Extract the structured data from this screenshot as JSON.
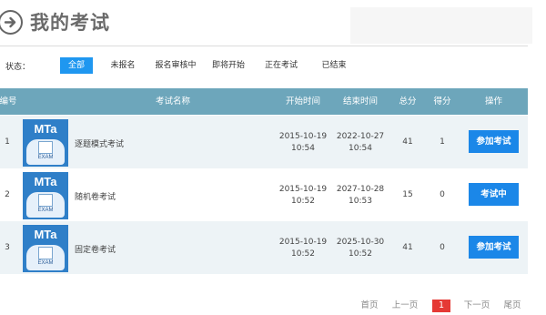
{
  "header": {
    "title": "我的考试"
  },
  "filter": {
    "label": "状态：",
    "items": [
      "全部",
      "未报名",
      "报名审核中",
      "即将开始",
      "正在考试",
      "已结束"
    ]
  },
  "table": {
    "columns": [
      "编号",
      "考试名称",
      "开始时间",
      "结束时间",
      "总分",
      "得分",
      "操作"
    ],
    "rows": [
      {
        "num": "1",
        "thumb_title": "MTa",
        "thumb_sub": "EXAM",
        "name": "逐题模式考试",
        "start_date": "2015-10-19",
        "start_time": "10:54",
        "end_date": "2022-10-27",
        "end_time": "10:54",
        "total": "41",
        "score": "1",
        "action": "参加考试"
      },
      {
        "num": "2",
        "thumb_title": "MTa",
        "thumb_sub": "EXAM",
        "name": "随机卷考试",
        "start_date": "2015-10-19",
        "start_time": "10:52",
        "end_date": "2027-10-28",
        "end_time": "10:53",
        "total": "15",
        "score": "0",
        "action": "考试中"
      },
      {
        "num": "3",
        "thumb_title": "MTa",
        "thumb_sub": "EXAM",
        "name": "固定卷考试",
        "start_date": "2015-10-19",
        "start_time": "10:52",
        "end_date": "2025-10-30",
        "end_time": "10:52",
        "total": "41",
        "score": "0",
        "action": "参加考试"
      }
    ]
  },
  "pager": {
    "first": "首页",
    "prev": "上一页",
    "current": "1",
    "next": "下一页",
    "last": "尾页"
  },
  "colors": {
    "accent": "#1f97f0",
    "table_header": "#6da6bb",
    "row_shade": "#edf3f6",
    "pager_current": "#e53935"
  }
}
